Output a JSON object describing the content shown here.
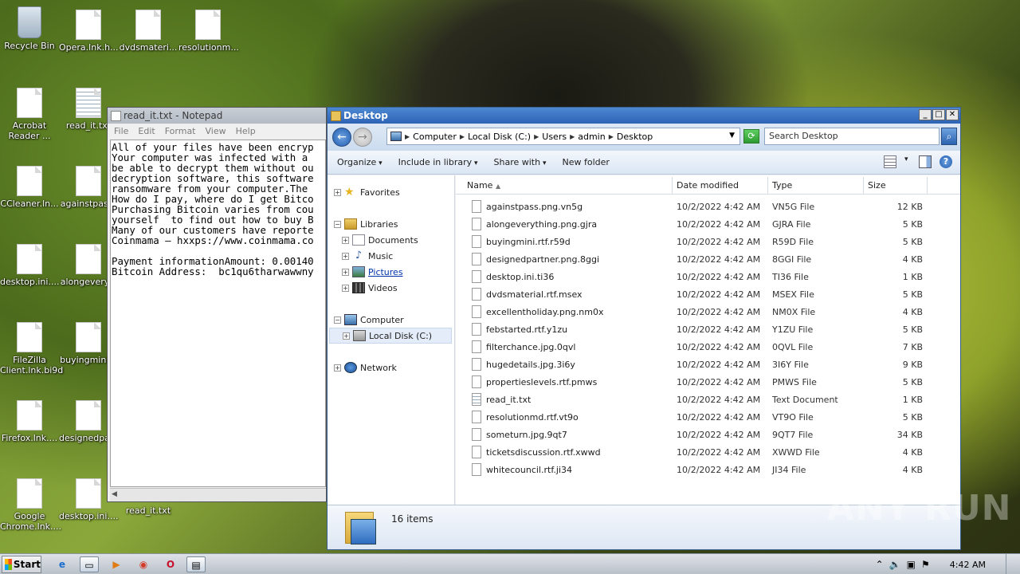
{
  "desktop": {
    "icons": [
      {
        "label": "Recycle Bin"
      },
      {
        "label": "Opera.lnk.h..."
      },
      {
        "label": "dvdsmateri..."
      },
      {
        "label": "resolutionm..."
      },
      {
        "label": "Acrobat Reader ..."
      },
      {
        "label": "read_it.txt"
      },
      {
        "label": "CCleaner.ln..."
      },
      {
        "label": "againstpas..."
      },
      {
        "label": "desktop.ini...."
      },
      {
        "label": "alongevery..."
      },
      {
        "label": "FileZilla Client.lnk.bi9d"
      },
      {
        "label": "buyingmini..."
      },
      {
        "label": "Firefox.lnk...."
      },
      {
        "label": "designedpa..."
      },
      {
        "label": "Google Chrome.lnk...."
      },
      {
        "label": "desktop.ini...."
      },
      {
        "label": "read_it.txt"
      }
    ]
  },
  "notepad": {
    "title": "read_it.txt - Notepad",
    "menu": [
      "File",
      "Edit",
      "Format",
      "View",
      "Help"
    ],
    "text": "All of your files have been encryp\nYour computer was infected with a \nbe able to decrypt them without ou\ndecryption software, this software\nransomware from your computer.The \nHow do I pay, where do I get Bitco\nPurchasing Bitcoin varies from cou\nyourself  to find out how to buy B\nMany of our customers have reporte\nCoinmama – hxxps://www.coinmama.co\n\nPayment informationAmount: 0.00140\nBitcoin Address:  bc1qu6tharwawwny"
  },
  "explorer": {
    "title": "Desktop",
    "breadcrumb": [
      "Computer",
      "Local Disk (C:)",
      "Users",
      "admin",
      "Desktop"
    ],
    "search_placeholder": "Search Desktop",
    "commands": {
      "organize": "Organize",
      "include": "Include in library",
      "share": "Share with",
      "new_folder": "New folder"
    },
    "nav": {
      "favorites": "Favorites",
      "libraries": "Libraries",
      "documents": "Documents",
      "music": "Music",
      "pictures": "Pictures",
      "videos": "Videos",
      "computer": "Computer",
      "local_disk": "Local Disk (C:)",
      "network": "Network"
    },
    "columns": {
      "name": "Name",
      "date": "Date modified",
      "type": "Type",
      "size": "Size"
    },
    "files": [
      {
        "name": "againstpass.png.vn5g",
        "date": "10/2/2022 4:42 AM",
        "type": "VN5G File",
        "size": "12 KB"
      },
      {
        "name": "alongeverything.png.gjra",
        "date": "10/2/2022 4:42 AM",
        "type": "GJRA File",
        "size": "5 KB"
      },
      {
        "name": "buyingmini.rtf.r59d",
        "date": "10/2/2022 4:42 AM",
        "type": "R59D File",
        "size": "5 KB"
      },
      {
        "name": "designedpartner.png.8ggi",
        "date": "10/2/2022 4:42 AM",
        "type": "8GGI File",
        "size": "4 KB"
      },
      {
        "name": "desktop.ini.ti36",
        "date": "10/2/2022 4:42 AM",
        "type": "TI36 File",
        "size": "1 KB"
      },
      {
        "name": "dvdsmaterial.rtf.msex",
        "date": "10/2/2022 4:42 AM",
        "type": "MSEX File",
        "size": "5 KB"
      },
      {
        "name": "excellentholiday.png.nm0x",
        "date": "10/2/2022 4:42 AM",
        "type": "NM0X File",
        "size": "4 KB"
      },
      {
        "name": "febstarted.rtf.y1zu",
        "date": "10/2/2022 4:42 AM",
        "type": "Y1ZU File",
        "size": "5 KB"
      },
      {
        "name": "filterchance.jpg.0qvl",
        "date": "10/2/2022 4:42 AM",
        "type": "0QVL File",
        "size": "7 KB"
      },
      {
        "name": "hugedetails.jpg.3i6y",
        "date": "10/2/2022 4:42 AM",
        "type": "3I6Y File",
        "size": "9 KB"
      },
      {
        "name": "propertieslevels.rtf.pmws",
        "date": "10/2/2022 4:42 AM",
        "type": "PMWS File",
        "size": "5 KB"
      },
      {
        "name": "read_it.txt",
        "date": "10/2/2022 4:42 AM",
        "type": "Text Document",
        "size": "1 KB"
      },
      {
        "name": "resolutionmd.rtf.vt9o",
        "date": "10/2/2022 4:42 AM",
        "type": "VT9O File",
        "size": "5 KB"
      },
      {
        "name": "someturn.jpg.9qt7",
        "date": "10/2/2022 4:42 AM",
        "type": "9QT7 File",
        "size": "34 KB"
      },
      {
        "name": "ticketsdiscussion.rtf.xwwd",
        "date": "10/2/2022 4:42 AM",
        "type": "XWWD File",
        "size": "4 KB"
      },
      {
        "name": "whitecouncil.rtf.ji34",
        "date": "10/2/2022 4:42 AM",
        "type": "JI34 File",
        "size": "4 KB"
      }
    ],
    "status": "16 items"
  },
  "watermark": "ANY RUN",
  "taskbar": {
    "start_label": "Start",
    "clock": "4:42 AM"
  }
}
